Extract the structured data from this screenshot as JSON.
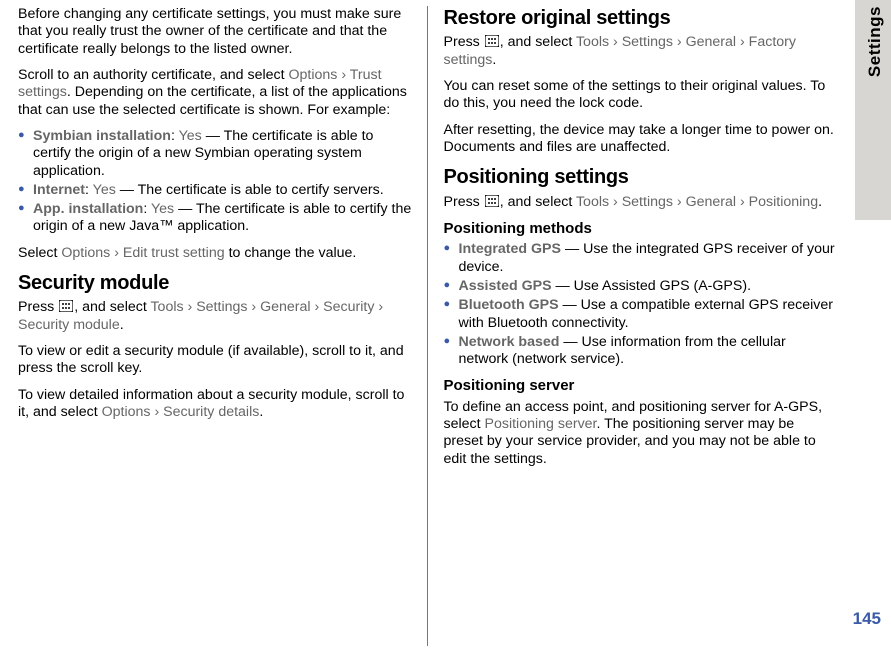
{
  "sideTab": "Settings",
  "pageNumber": "145",
  "left": {
    "p1": "Before changing any certificate settings, you must make sure that you really trust the owner of the certificate and that the certificate really belongs to the listed owner.",
    "p2a": "Scroll to an authority certificate, and select ",
    "opt": "Options",
    "arrow": "›",
    "trust": "Trust settings",
    "p2b": ". Depending on the certificate, a list of the applications that can use the selected certificate is shown. For example:",
    "bullets": [
      {
        "key": "Symbian installation",
        "val": "Yes",
        "rest": " — The certificate is able to certify the origin of a new Symbian operating system application."
      },
      {
        "key": "Internet",
        "val": "Yes",
        "rest": " — The certificate is able to certify servers."
      },
      {
        "key": "App. installation",
        "val": "Yes",
        "rest": " — The certificate is able to certify the origin of a new Java™ application."
      }
    ],
    "p3a": "Select ",
    "opt2": "Options",
    "edit": "Edit trust setting",
    "p3b": " to change the value.",
    "h_secmod": "Security module",
    "p4a": "Press ",
    "p4b": ", and select ",
    "tools": "Tools",
    "settings": "Settings",
    "general": "General",
    "security": "Security",
    "secmodule": "Security module",
    "p5": "To view or edit a security module (if available), scroll to it, and press the scroll key.",
    "p6a": "To view detailed information about a security module, scroll to it, and select ",
    "opt3": "Options",
    "secdetails": "Security details",
    "dot": "."
  },
  "right": {
    "h_restore": "Restore original settings",
    "p1a": "Press ",
    "p1b": ", and select ",
    "tools": "Tools",
    "settings": "Settings",
    "general": "General",
    "factory": "Factory settings",
    "arrow": "›",
    "dot": ".",
    "p2": "You can reset some of the settings to their original values. To do this, you need the lock code.",
    "p3": "After resetting, the device may take a longer time to power on. Documents and files are unaffected.",
    "h_pos": "Positioning settings",
    "p4a": "Press ",
    "p4b": ", and select ",
    "positioning": "Positioning",
    "sub_methods": "Positioning methods",
    "bullets": [
      {
        "key": "Integrated GPS",
        "rest": " — Use the integrated GPS receiver of your device."
      },
      {
        "key": "Assisted GPS",
        "rest": " — Use Assisted GPS (A-GPS)."
      },
      {
        "key": "Bluetooth GPS",
        "rest": " — Use a compatible external GPS receiver with Bluetooth connectivity."
      },
      {
        "key": "Network based",
        "rest": " — Use information from the cellular network (network service)."
      }
    ],
    "sub_server": "Positioning server",
    "p5a": "To define an access point, and positioning server for A-GPS, select ",
    "posserver": "Positioning server",
    "p5b": ". The positioning server may be preset by your service provider, and you may not be able to edit the settings."
  }
}
